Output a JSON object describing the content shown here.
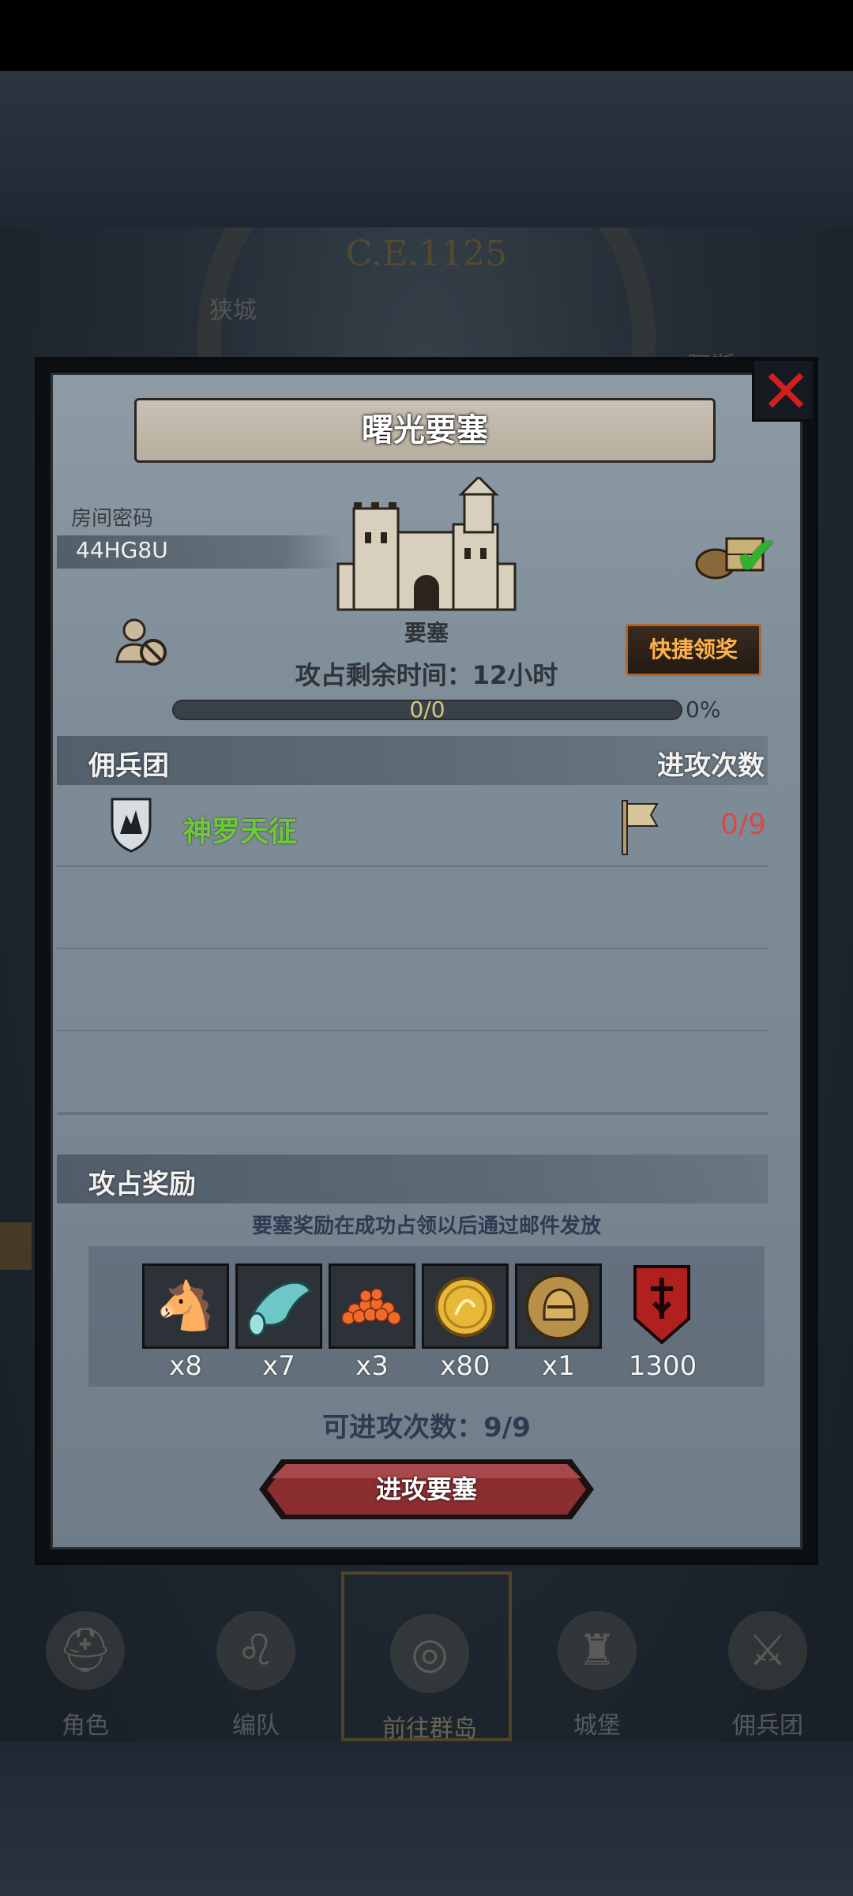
{
  "background": {
    "era": "C.E.1125",
    "city_left": "狭城",
    "city_right": "阿斯"
  },
  "nav": {
    "items": [
      {
        "label": "角色",
        "icon": "helmet-icon"
      },
      {
        "label": "编队",
        "icon": "lion-icon"
      },
      {
        "label": "前往群岛",
        "icon": "globe-icon"
      },
      {
        "label": "城堡",
        "icon": "castle-icon"
      },
      {
        "label": "佣兵团",
        "icon": "mercenary-icon"
      }
    ]
  },
  "dialog": {
    "title": "曙光要塞",
    "room_password_label": "房间密码",
    "room_code": "44HG8U",
    "building_name": "要塞",
    "time_left": "攻占剩余时间：12小时",
    "quick_claim": "快捷领奖",
    "progress": {
      "text": "0/0",
      "percent_label": "0%",
      "fraction": 0
    },
    "mercenary_header": "佣兵团",
    "attack_count_header": "进攻次数",
    "mercenaries": [
      {
        "name": "神罗天征",
        "count": "0/9",
        "name_color": "#6fc83a"
      }
    ],
    "reward_header": "攻占奖励",
    "reward_note": "要塞奖励在成功占领以后通过邮件发放",
    "rewards": [
      {
        "icon": "horse-icon",
        "qty": "x8"
      },
      {
        "icon": "cloth-icon",
        "qty": "x7"
      },
      {
        "icon": "caviar-icon",
        "qty": "x3"
      },
      {
        "icon": "gold-coin-icon",
        "qty": "x80"
      },
      {
        "icon": "knight-medal-icon",
        "qty": "x1"
      },
      {
        "icon": "red-banner-icon",
        "qty": "1300"
      }
    ],
    "attacks_remaining": "可进攻次数：9/9",
    "attack_button": "进攻要塞"
  },
  "colors": {
    "panel": "#7e8c97",
    "accent_orange": "#ffb24a",
    "merc_green": "#6fc83a",
    "count_red": "#d64a4a",
    "close_red": "#d41d1d",
    "attack_btn": "#8a2e30"
  }
}
